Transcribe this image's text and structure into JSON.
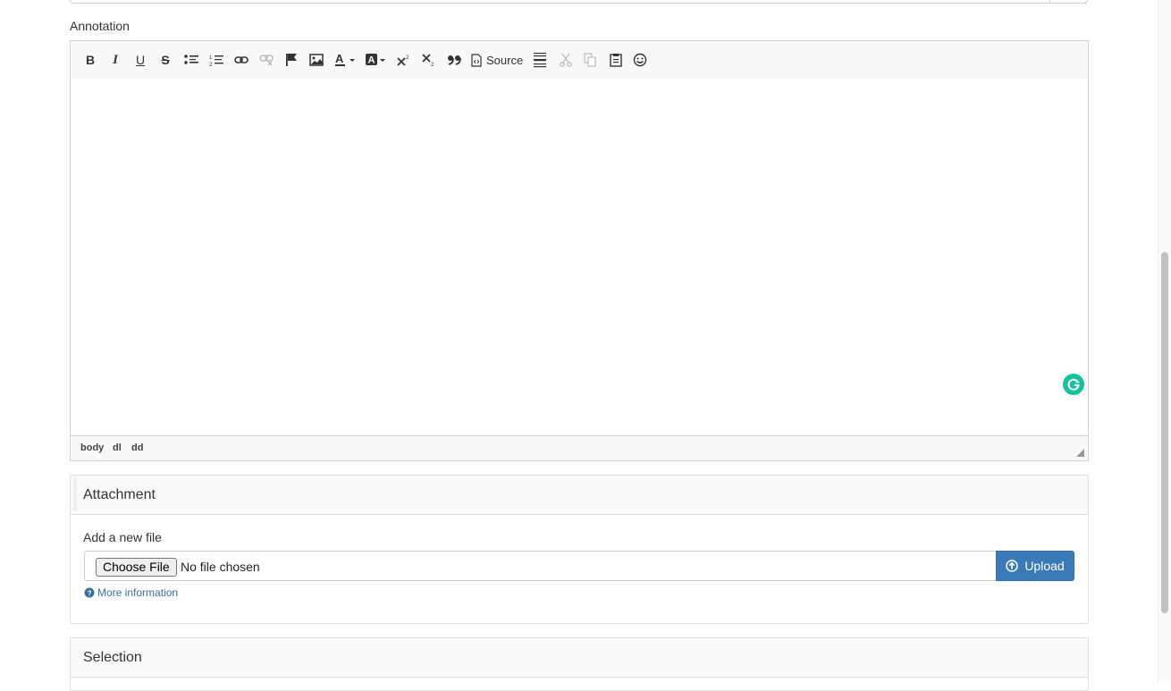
{
  "annotation": {
    "label": "Annotation",
    "toolbar": {
      "bold": "B",
      "italic": "I",
      "underline": "U",
      "strike": "S",
      "source_label": "Source"
    },
    "statusbar": [
      "body",
      "dl",
      "dd"
    ]
  },
  "attachment": {
    "title": "Attachment",
    "add_label": "Add a new file",
    "choose_label": "Choose File",
    "no_file": "No file chosen",
    "upload_label": "Upload",
    "more_info": "More information"
  },
  "selection": {
    "title": "Selection"
  },
  "colors": {
    "upload": "#3a7ab8",
    "link": "#3a6f9f",
    "grammarly": "#15c39a"
  }
}
